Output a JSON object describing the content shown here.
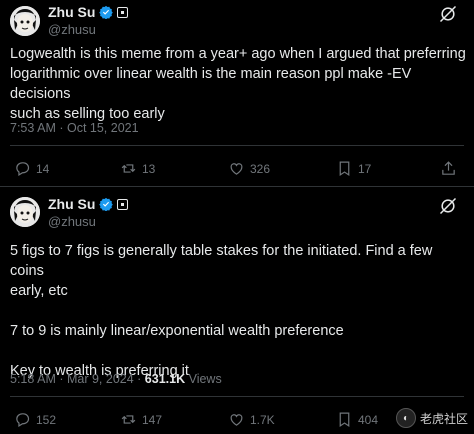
{
  "tweets": [
    {
      "name": "Zhu Su",
      "handle": "@zhusu",
      "text_lines": [
        "Logwealth is this meme from a year+ ago when I argued that preferring",
        "logarithmic over linear wealth is the main reason ppl make -EV decisions",
        "such as selling too early"
      ],
      "timestamp": "7:53 AM · Oct 15, 2021",
      "replies": "14",
      "reposts": "13",
      "likes": "326",
      "bookmarks": "17"
    },
    {
      "name": "Zhu Su",
      "handle": "@zhusu",
      "text_lines": [
        "5 figs to 7 figs is generally table stakes for the initiated. Find a few coins",
        "early, etc",
        "",
        "7 to 9 is mainly linear/exponential wealth preference",
        "",
        "Key to wealth is preferring it"
      ],
      "timestamp": "5:18 AM · Mar 9, 2024 · ",
      "views_count": "631.1K",
      "views_label": "Views",
      "replies": "152",
      "reposts": "147",
      "likes": "1.7K",
      "bookmarks": "404"
    }
  ],
  "watermark": {
    "text": "老虎社区"
  },
  "colors": {
    "background": "#000000",
    "text": "#e7e9ea",
    "muted": "#71767b",
    "verified": "#1d9bf0"
  }
}
